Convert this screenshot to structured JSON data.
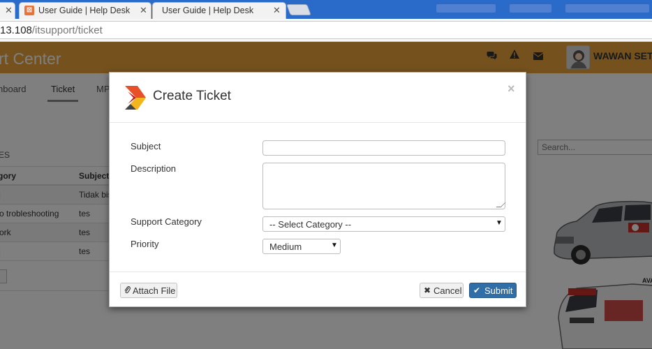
{
  "browser": {
    "tabs": [
      {
        "title": "User Guide | Help Desk"
      },
      {
        "title": "User Guide | Help Desk"
      }
    ],
    "url_host": "13.108",
    "url_path": "/itsupport/ticket"
  },
  "app": {
    "title": "rt Center",
    "user_name": "WAWAN SET",
    "header_color": "#e8a33a"
  },
  "nav": {
    "items": [
      {
        "label": "hboard"
      },
      {
        "label": "Ticket"
      },
      {
        "label": "MP"
      }
    ]
  },
  "background": {
    "section_label": "ES",
    "table": {
      "columns": [
        "gory",
        "Subject"
      ],
      "rows": [
        {
          "category": "",
          "subject": "Tidak bis"
        },
        {
          "category": "o trobleshooting",
          "subject": "tes"
        },
        {
          "category": "ork",
          "subject": "tes"
        },
        {
          "category": "",
          "subject": "tes"
        }
      ]
    },
    "search_placeholder": "Search...",
    "banner_text": "AVA"
  },
  "modal": {
    "title": "Create Ticket",
    "close_symbol": "×",
    "fields": {
      "subject_label": "Subject",
      "subject_value": "",
      "description_label": "Description",
      "description_value": "",
      "category_label": "Support Category",
      "category_selected": "-- Select Category --",
      "priority_label": "Priority",
      "priority_selected": "Medium"
    },
    "buttons": {
      "attach": "Attach File",
      "cancel": "Cancel",
      "submit": "Submit"
    },
    "primary_color": "#2f6ea7"
  }
}
